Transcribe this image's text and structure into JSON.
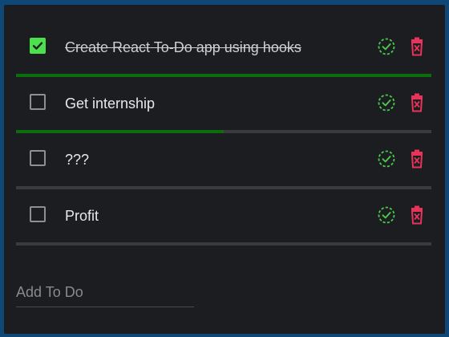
{
  "colors": {
    "page_bg": "#0f4777",
    "card_bg": "#1c1d21",
    "check_green": "#4ce04c",
    "complete_icon": "#4cc84c",
    "delete_icon": "#e8335a",
    "progress_fill": "#0c6d0c",
    "progress_track": "#3a3b3e"
  },
  "todos": [
    {
      "label": "Create React To-Do app using hooks",
      "checked": true,
      "progress": 1.0
    },
    {
      "label": "Get internship",
      "checked": false,
      "progress": 0.5
    },
    {
      "label": "???",
      "checked": false,
      "progress": 0.0
    },
    {
      "label": "Profit",
      "checked": false,
      "progress": 0.0
    }
  ],
  "icons": {
    "complete": "dashed-circle-check-icon",
    "delete": "trash-icon",
    "checkbox": "checkbox-icon"
  },
  "add_todo": {
    "placeholder": "Add To Do",
    "value": ""
  }
}
